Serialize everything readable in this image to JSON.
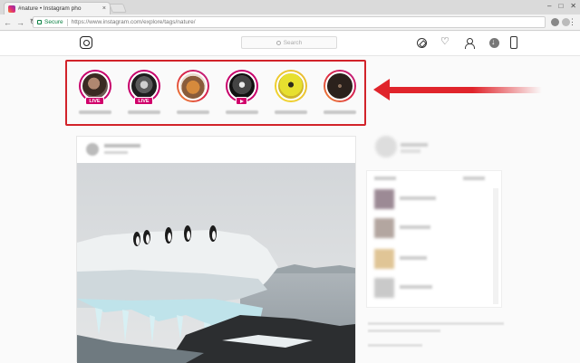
{
  "browser": {
    "tab_title": "#nature • Instagram pho",
    "tab_close": "×",
    "url_secure_label": "Secure",
    "url": "https://www.instagram.com/explore/tags/nature/"
  },
  "instagram": {
    "search_placeholder": "Search"
  },
  "stories": [
    {
      "badge": "LIVE",
      "ring": "live"
    },
    {
      "badge": "LIVE",
      "ring": "live"
    },
    {
      "badge": "",
      "ring": "gradient"
    },
    {
      "badge": "play",
      "ring": "live"
    },
    {
      "badge": "",
      "ring": "yellow"
    },
    {
      "badge": "",
      "ring": "gradient"
    }
  ],
  "colors": {
    "highlight_box": "#d2232a",
    "arrow": "#e0242b",
    "live_badge": "#d1006b"
  }
}
